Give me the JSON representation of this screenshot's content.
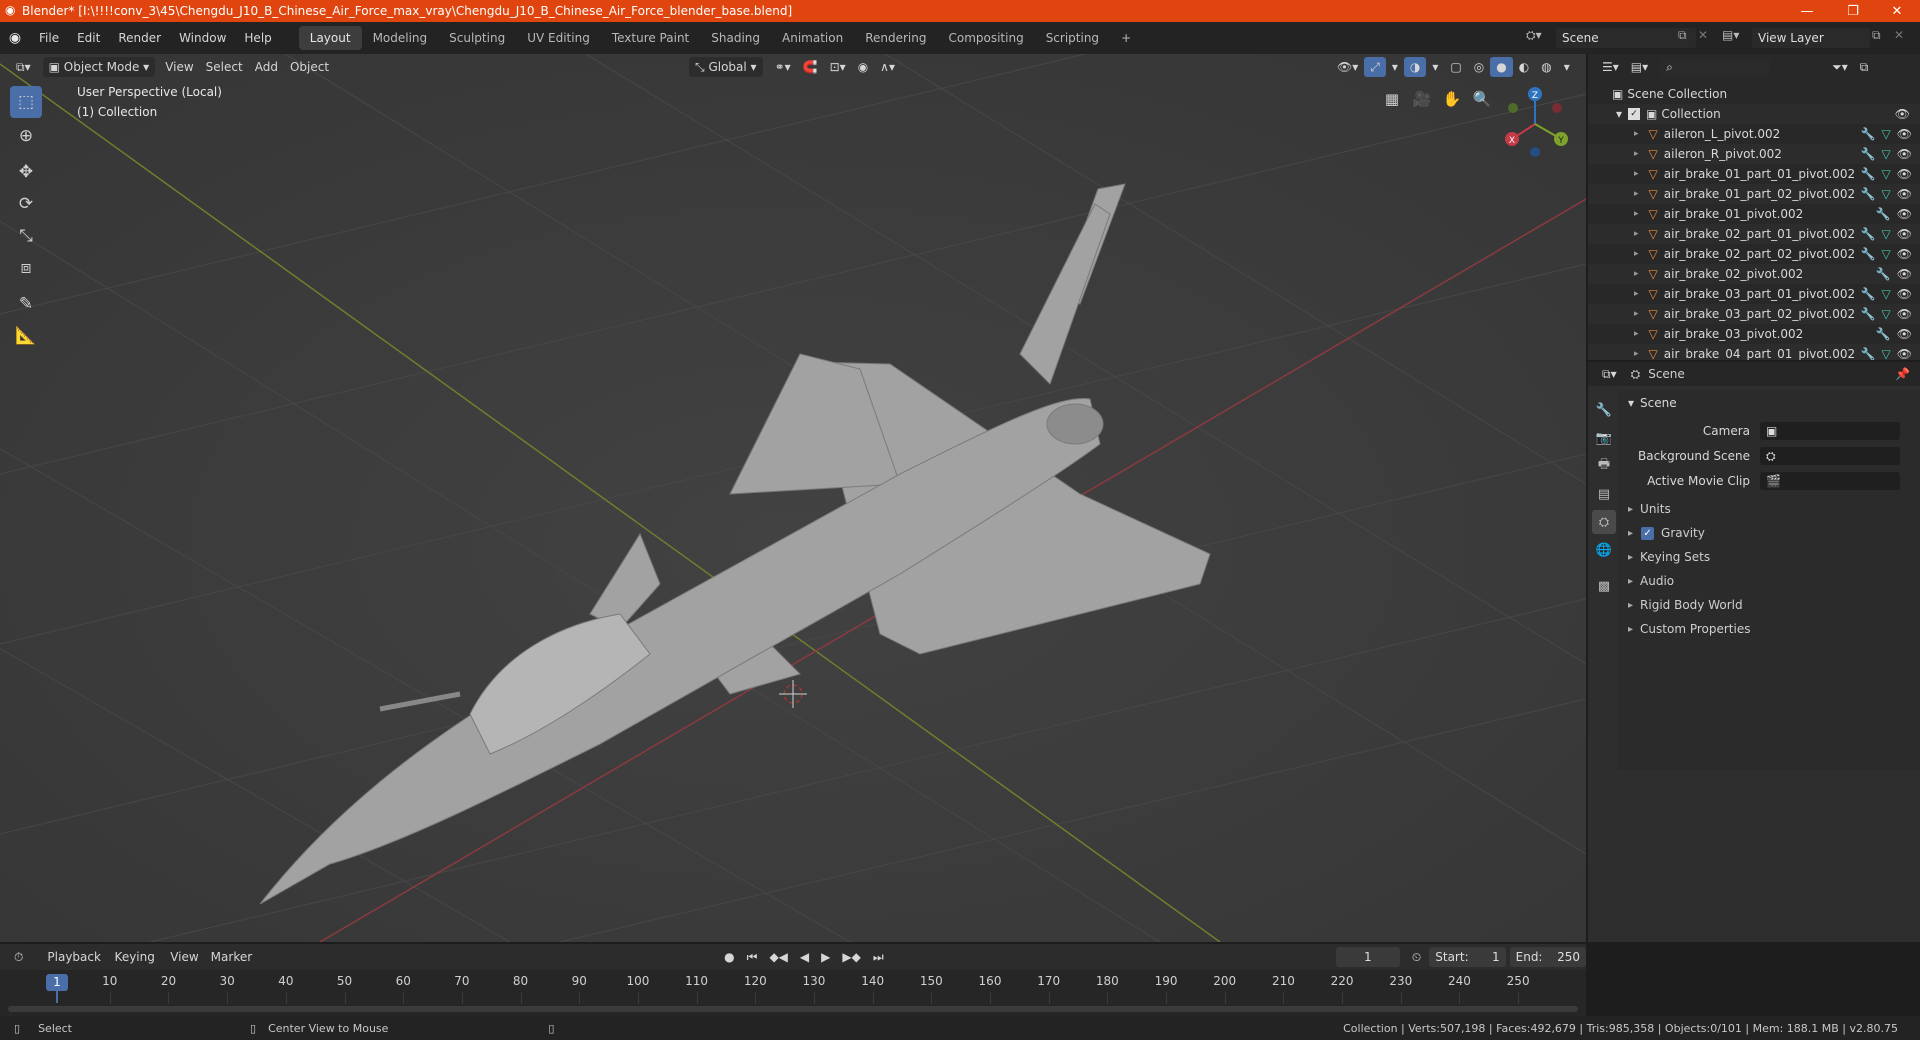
{
  "window": {
    "title": "Blender* [I:\\!!!!conv_3\\45\\Chengdu_J10_B_Chinese_Air_Force_max_vray\\Chengdu_J10_B_Chinese_Air_Force_blender_base.blend]",
    "minimize": "—",
    "restore": "❐",
    "close": "✕"
  },
  "menu": {
    "file": "File",
    "edit": "Edit",
    "render": "Render",
    "window": "Window",
    "help": "Help"
  },
  "workspaces": [
    "Layout",
    "Modeling",
    "Sculpting",
    "UV Editing",
    "Texture Paint",
    "Shading",
    "Animation",
    "Rendering",
    "Compositing",
    "Scripting"
  ],
  "active_workspace": "Layout",
  "scene_field": "Scene",
  "view_layer_field": "View Layer",
  "viewport": {
    "mode": "Object Mode",
    "view": "View",
    "select": "Select",
    "add": "Add",
    "object": "Object",
    "orientation": "Global",
    "perspective": "User Perspective (Local)",
    "collection": "(1) Collection",
    "gizmo_x": "X",
    "gizmo_y": "Y",
    "gizmo_z": "Z"
  },
  "outliner": {
    "root": "Scene Collection",
    "collection": "Collection",
    "items": [
      "aileron_L_pivot.002",
      "aileron_R_pivot.002",
      "air_brake_01_part_01_pivot.002",
      "air_brake_01_part_02_pivot.002",
      "air_brake_01_pivot.002",
      "air_brake_02_part_01_pivot.002",
      "air_brake_02_part_02_pivot.002",
      "air_brake_02_pivot.002",
      "air_brake_03_part_01_pivot.002",
      "air_brake_03_part_02_pivot.002",
      "air_brake_03_pivot.002",
      "air_brake_04_part_01_pivot.002"
    ]
  },
  "properties": {
    "header": "Scene",
    "panel": "Scene",
    "camera_label": "Camera",
    "bg_scene_label": "Background Scene",
    "movie_clip_label": "Active Movie Clip",
    "sections": [
      "Units",
      "Gravity",
      "Keying Sets",
      "Audio",
      "Rigid Body World",
      "Custom Properties"
    ],
    "gravity_checked": true
  },
  "timeline": {
    "playback": "Playback",
    "keying": "Keying",
    "view": "View",
    "marker": "Marker",
    "current_frame": "1",
    "start_label": "Start:",
    "start": "1",
    "end_label": "End:",
    "end": "250",
    "ticks": [
      "10",
      "20",
      "30",
      "40",
      "50",
      "60",
      "70",
      "80",
      "90",
      "100",
      "110",
      "120",
      "130",
      "140",
      "150",
      "160",
      "170",
      "180",
      "190",
      "200",
      "210",
      "220",
      "230",
      "240",
      "250"
    ]
  },
  "status": {
    "select": "Select",
    "center": "Center View to Mouse",
    "stats": "Collection | Verts:507,198 | Faces:492,679 | Tris:985,358 | Objects:0/101 | Mem: 188.1 MB | v2.80.75"
  },
  "colors": {
    "titlebar": "#e0450f",
    "accent": "#4a6ea8",
    "x_axis": "#c53a47",
    "y_axis": "#7fa32a",
    "z_axis": "#2f74c0"
  }
}
